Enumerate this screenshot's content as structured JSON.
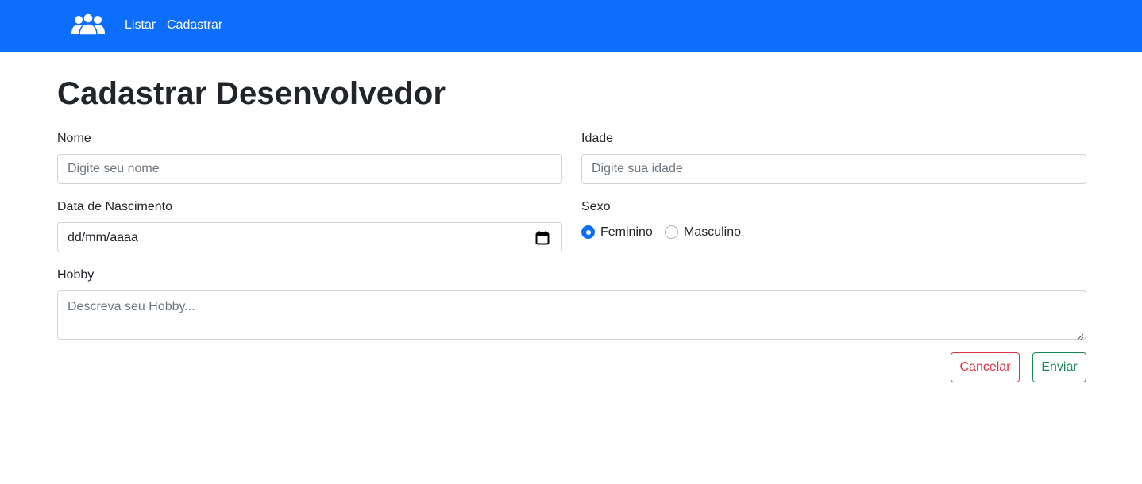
{
  "navbar": {
    "brand_icon": "users-icon",
    "links": [
      {
        "label": "Listar"
      },
      {
        "label": "Cadastrar"
      }
    ]
  },
  "page": {
    "title": "Cadastrar Desenvolvedor"
  },
  "form": {
    "nome": {
      "label": "Nome",
      "placeholder": "Digite seu nome",
      "value": ""
    },
    "idade": {
      "label": "Idade",
      "placeholder": "Digite sua idade",
      "value": ""
    },
    "nascimento": {
      "label": "Data de Nascimento",
      "value": "dd/mm/aaaa",
      "icon": "calendar-icon"
    },
    "sexo": {
      "label": "Sexo",
      "options": [
        {
          "label": "Feminino",
          "checked": true
        },
        {
          "label": "Masculino",
          "checked": false
        }
      ]
    },
    "hobby": {
      "label": "Hobby",
      "placeholder": "Descreva seu Hobby..."
    },
    "buttons": {
      "cancel": "Cancelar",
      "submit": "Enviar"
    }
  },
  "colors": {
    "primary": "#0d6efd",
    "danger": "#dc3545",
    "success": "#198754",
    "text": "#212529",
    "placeholder": "#6c757d",
    "border": "#ced4da"
  }
}
